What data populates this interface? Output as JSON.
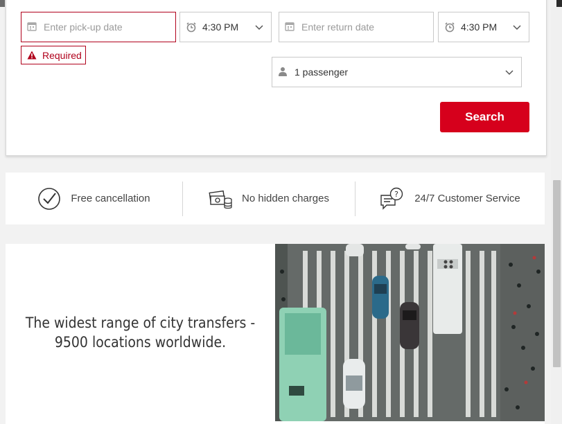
{
  "form": {
    "pickup_date_placeholder": "Enter pick-up date",
    "pickup_time": "4:30 PM",
    "return_date_placeholder": "Enter return date",
    "return_time": "4:30 PM",
    "required_label": "Required",
    "passengers": "1 passenger",
    "search_label": "Search"
  },
  "features": [
    {
      "label": "Free cancellation",
      "icon": "check-circle-icon"
    },
    {
      "label": "No hidden charges",
      "icon": "money-icon"
    },
    {
      "label": "24/7 Customer Service",
      "icon": "chat-question-icon"
    }
  ],
  "promo": {
    "line1": "The widest range of city transfers -",
    "line2": "9500 locations worldwide."
  },
  "colors": {
    "accent": "#d6001c",
    "error": "#b0001b"
  }
}
